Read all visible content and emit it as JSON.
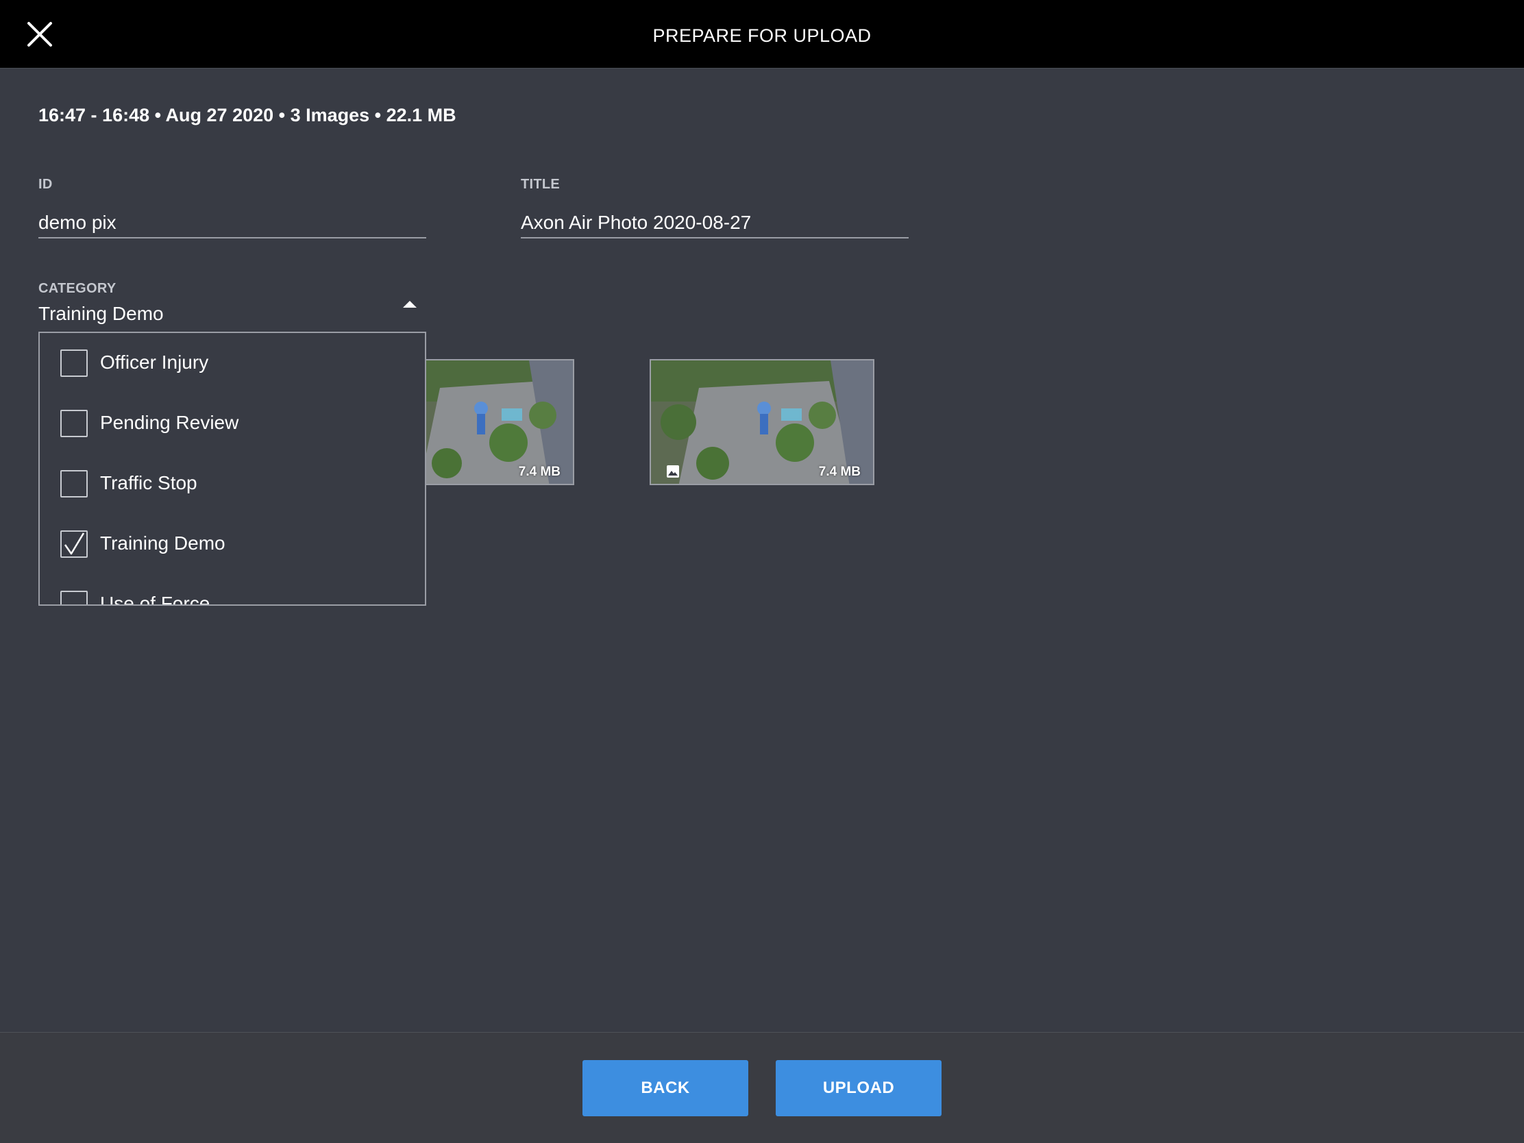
{
  "header": {
    "title": "PREPARE FOR UPLOAD",
    "close_icon": "close-icon"
  },
  "summary": "16:47 - 16:48 • Aug 27 2020 • 3 Images • 22.1 MB",
  "form": {
    "id_label": "ID",
    "id_value": "demo pix",
    "title_label": "TITLE",
    "title_value": "Axon Air Photo 2020-08-27",
    "category_label": "CATEGORY",
    "category_value": "Training Demo",
    "category_caret_icon": "caret-up-icon"
  },
  "category_options": [
    {
      "label": "Officer Injury",
      "checked": false
    },
    {
      "label": "Pending Review",
      "checked": false
    },
    {
      "label": "Traffic Stop",
      "checked": false
    },
    {
      "label": "Training Demo",
      "checked": true
    },
    {
      "label": "Use of Force",
      "checked": false
    }
  ],
  "thumbnails": [
    {
      "size": "7.4 MB",
      "icon": "image-icon"
    },
    {
      "size": "7.4 MB",
      "icon": "image-icon"
    }
  ],
  "footer": {
    "back_label": "BACK",
    "upload_label": "UPLOAD"
  },
  "colors": {
    "background": "#383b44",
    "header": "#000000",
    "accent": "#3d8ee0"
  }
}
